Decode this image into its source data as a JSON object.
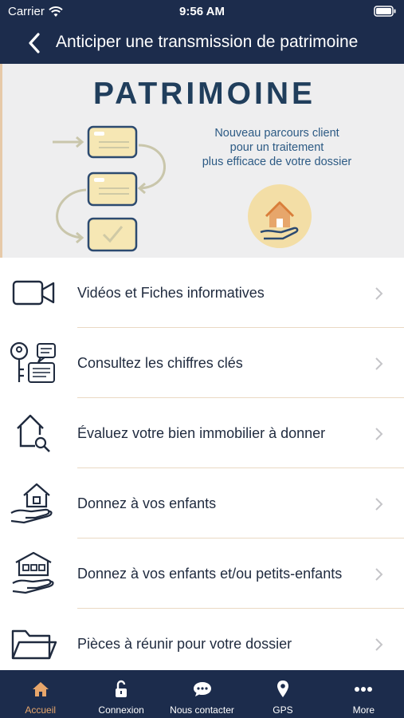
{
  "status_bar": {
    "carrier": "Carrier",
    "time": "9:56 AM"
  },
  "nav": {
    "title": "Anticiper une transmission de patrimoine"
  },
  "banner": {
    "brand": "PATRIMOINE",
    "tagline_lines": [
      "Nouveau parcours client",
      "pour un traitement",
      "plus efficace de votre dossier"
    ]
  },
  "list": {
    "items": [
      {
        "label": "Vidéos et Fiches informatives",
        "icon": "video-camera-icon"
      },
      {
        "label": "Consultez les chiffres clés",
        "icon": "key-document-icon"
      },
      {
        "label": "Évaluez votre bien immobilier à donner",
        "icon": "house-search-icon"
      },
      {
        "label": "Donnez à vos enfants",
        "icon": "hand-house-icon"
      },
      {
        "label": "Donnez à vos enfants et/ou petits-enfants",
        "icon": "hand-building-icon"
      },
      {
        "label": "Pièces à réunir pour votre dossier",
        "icon": "folder-icon"
      }
    ]
  },
  "tab_bar": {
    "tabs": [
      {
        "label": "Accueil",
        "icon": "home-icon",
        "active": true
      },
      {
        "label": "Connexion",
        "icon": "unlock-icon",
        "active": false
      },
      {
        "label": "Nous contacter",
        "icon": "chat-bubble-icon",
        "active": false
      },
      {
        "label": "GPS",
        "icon": "location-pin-icon",
        "active": false
      },
      {
        "label": "More",
        "icon": "more-dots-icon",
        "active": false
      }
    ]
  },
  "colors": {
    "navy": "#1c2c4c",
    "accent": "#e7a66b",
    "separator": "#ead9c3",
    "banner_blue": "#2c5a84"
  }
}
